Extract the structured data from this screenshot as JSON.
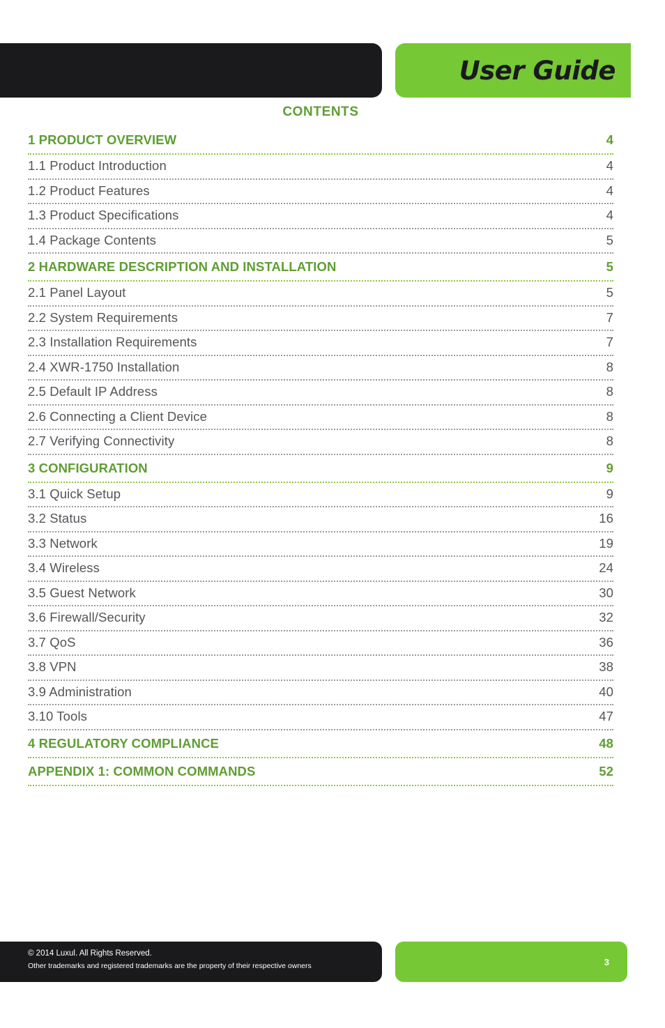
{
  "header": {
    "title": "User Guide"
  },
  "contents": {
    "heading": "CONTENTS",
    "entries": [
      {
        "level": 1,
        "label": "1 PRODUCT OVERVIEW",
        "page": "4"
      },
      {
        "level": 2,
        "label": "1.1 Product Introduction",
        "page": "4"
      },
      {
        "level": 2,
        "label": "1.2 Product Features",
        "page": "4"
      },
      {
        "level": 2,
        "label": "1.3 Product Specifications",
        "page": "4"
      },
      {
        "level": 2,
        "label": "1.4 Package Contents",
        "page": "5"
      },
      {
        "level": 1,
        "label": "2 HARDWARE DESCRIPTION AND INSTALLATION",
        "page": "5"
      },
      {
        "level": 2,
        "label": "2.1 Panel Layout",
        "page": "5"
      },
      {
        "level": 2,
        "label": "2.2 System Requirements",
        "page": "7"
      },
      {
        "level": 2,
        "label": "2.3 Installation Requirements",
        "page": "7"
      },
      {
        "level": 2,
        "label": "2.4 XWR-1750 Installation",
        "page": "8"
      },
      {
        "level": 2,
        "label": "2.5 Default IP Address",
        "page": "8"
      },
      {
        "level": 2,
        "label": "2.6 Connecting a Client Device",
        "page": "8"
      },
      {
        "level": 2,
        "label": "2.7 Verifying Connectivity",
        "page": "8"
      },
      {
        "level": 1,
        "label": "3 CONFIGURATION",
        "page": "9"
      },
      {
        "level": 2,
        "label": "3.1 Quick Setup",
        "page": "9"
      },
      {
        "level": 2,
        "label": "3.2 Status",
        "page": "16"
      },
      {
        "level": 2,
        "label": "3.3 Network",
        "page": "19"
      },
      {
        "level": 2,
        "label": "3.4 Wireless",
        "page": "24"
      },
      {
        "level": 2,
        "label": "3.5 Guest Network",
        "page": "30"
      },
      {
        "level": 2,
        "label": "3.6 Firewall/Security",
        "page": "32"
      },
      {
        "level": 2,
        "label": "3.7 QoS",
        "page": "36"
      },
      {
        "level": 2,
        "label": "3.8 VPN",
        "page": "38"
      },
      {
        "level": 2,
        "label": "3.9 Administration",
        "page": "40"
      },
      {
        "level": 2,
        "label": "3.10 Tools",
        "page": "47"
      },
      {
        "level": 1,
        "label": "4 REGULATORY COMPLIANCE",
        "page": "48"
      },
      {
        "level": 1,
        "label": "APPENDIX 1: COMMON COMMANDS",
        "page": "52"
      }
    ]
  },
  "footer": {
    "copyright": "© 2014  Luxul. All Rights Reserved.",
    "trademark": "Other trademarks and registered trademarks are the property of their respective owners",
    "page_number": "3"
  },
  "colors": {
    "brand_green": "#76c935",
    "heading_green": "#5f9e33",
    "leader_green": "#8cc63f",
    "dark": "#1a1a1c",
    "body_gray": "#55555a",
    "leader_gray": "#9a9a9a"
  }
}
